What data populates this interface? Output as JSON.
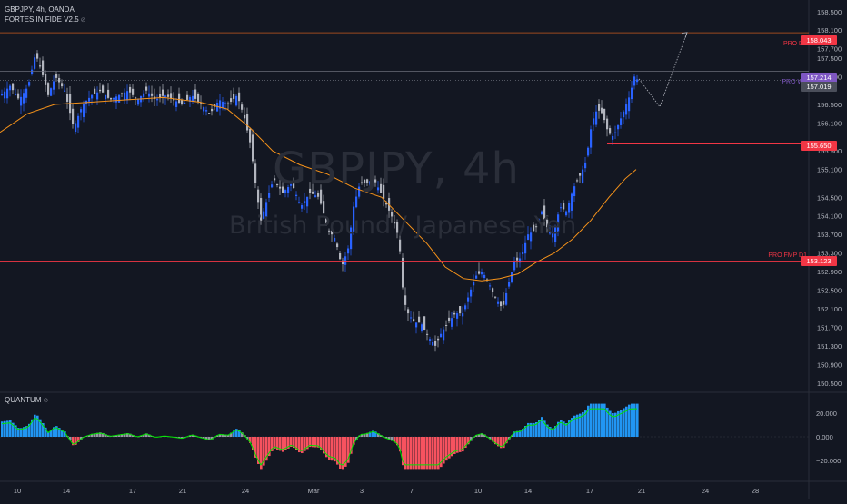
{
  "header": {
    "symbol_line": "GBPJPY, 4h, OANDA",
    "indicator_line": "FORTES IN FIDE V2.5",
    "eye_icon": "eye-slash-icon"
  },
  "watermark": {
    "symbol": "GBPJPY, 4h",
    "description": "British Pound / Japanese Yen"
  },
  "price_axis": {
    "ticks": [
      "158.500",
      "158.100",
      "157.700",
      "157.500",
      "157.100",
      "156.500",
      "156.100",
      "155.500",
      "155.100",
      "154.500",
      "154.100",
      "153.700",
      "153.300",
      "152.900",
      "152.500",
      "152.100",
      "151.700",
      "151.300",
      "150.900",
      "150.500"
    ],
    "tick_values": [
      158.5,
      158.1,
      157.7,
      157.5,
      157.1,
      156.5,
      156.1,
      155.5,
      155.1,
      154.5,
      154.1,
      153.7,
      153.3,
      152.9,
      152.5,
      152.1,
      151.7,
      151.3,
      150.9,
      150.5
    ]
  },
  "levels": [
    {
      "name": "PRO D1",
      "value": "158.043",
      "price": 158.043,
      "color": "#f23645",
      "line_color": "#9c4a1f",
      "label_color": "#f23645"
    },
    {
      "name": "PRO W1",
      "value": "157.214",
      "price": 157.214,
      "color": "#7e57c2",
      "line_color": "#6a6d78",
      "label_color": "#7e57c2"
    },
    {
      "name": "",
      "value": "155.650",
      "price": 155.65,
      "color": "#f23645",
      "line_color": "#f23645",
      "label_color": "#f23645"
    },
    {
      "name": "PRO FMP D1",
      "value": "153.123",
      "price": 153.123,
      "color": "#f23645",
      "line_color": "#f23645",
      "label_color": "#f23645"
    }
  ],
  "last_price": {
    "value": "157.019",
    "price": 157.019,
    "color": "#4a4e5a"
  },
  "time_axis": {
    "labels": [
      "10",
      "14",
      "17",
      "21",
      "24",
      "Mar",
      "3",
      "7",
      "10",
      "14",
      "17",
      "21",
      "24",
      "28"
    ]
  },
  "sub_pane": {
    "title": "QUANTUM",
    "eye_icon": "eye-slash-icon",
    "ticks": [
      "20.000",
      "0.000",
      "−20.000"
    ],
    "tick_values": [
      20,
      0,
      -20
    ]
  },
  "colors": {
    "background": "#131722",
    "bull": "#2962ff",
    "bear": "#b2b5be",
    "ma": "#f7931a",
    "hist_pos": "#2196f3",
    "hist_neg": "#f7525f",
    "hist_neutral": "#9598a1",
    "signal": "#00e600",
    "grid": "#1e222d"
  },
  "chart_data": {
    "type": "candlestick",
    "timeframe": "4h",
    "ylim": [
      150.3,
      158.75
    ],
    "close_path": [
      [
        0,
        156.7
      ],
      [
        10,
        156.9
      ],
      [
        20,
        156.6
      ],
      [
        30,
        156.9
      ],
      [
        38,
        157.6
      ],
      [
        45,
        157.2
      ],
      [
        52,
        156.7
      ],
      [
        60,
        157.1
      ],
      [
        70,
        156.8
      ],
      [
        80,
        156.0
      ],
      [
        90,
        156.5
      ],
      [
        100,
        156.7
      ],
      [
        110,
        156.8
      ],
      [
        120,
        156.6
      ],
      [
        130,
        156.7
      ],
      [
        140,
        156.8
      ],
      [
        150,
        156.6
      ],
      [
        160,
        156.8
      ],
      [
        170,
        156.6
      ],
      [
        180,
        156.7
      ],
      [
        190,
        156.6
      ],
      [
        200,
        156.5
      ],
      [
        210,
        156.7
      ],
      [
        220,
        156.5
      ],
      [
        230,
        156.3
      ],
      [
        240,
        156.6
      ],
      [
        250,
        156.5
      ],
      [
        260,
        156.7
      ],
      [
        268,
        156.2
      ],
      [
        275,
        155.6
      ],
      [
        280,
        154.8
      ],
      [
        286,
        154.0
      ],
      [
        292,
        154.4
      ],
      [
        300,
        154.9
      ],
      [
        310,
        154.6
      ],
      [
        320,
        154.8
      ],
      [
        330,
        154.3
      ],
      [
        340,
        154.6
      ],
      [
        350,
        154.5
      ],
      [
        360,
        153.8
      ],
      [
        368,
        153.6
      ],
      [
        375,
        153.0
      ],
      [
        382,
        153.4
      ],
      [
        388,
        154.3
      ],
      [
        395,
        154.8
      ],
      [
        402,
        154.8
      ],
      [
        410,
        154.9
      ],
      [
        418,
        154.6
      ],
      [
        425,
        154.3
      ],
      [
        432,
        154.0
      ],
      [
        438,
        153.6
      ],
      [
        443,
        152.3
      ],
      [
        448,
        152.0
      ],
      [
        455,
        151.8
      ],
      [
        462,
        151.8
      ],
      [
        470,
        151.5
      ],
      [
        478,
        151.3
      ],
      [
        485,
        151.6
      ],
      [
        492,
        151.8
      ],
      [
        500,
        152.0
      ],
      [
        508,
        152.0
      ],
      [
        515,
        152.4
      ],
      [
        522,
        152.8
      ],
      [
        530,
        152.9
      ],
      [
        538,
        152.6
      ],
      [
        545,
        152.3
      ],
      [
        552,
        152.1
      ],
      [
        558,
        152.6
      ],
      [
        565,
        153.1
      ],
      [
        572,
        153.2
      ],
      [
        580,
        153.7
      ],
      [
        588,
        153.8
      ],
      [
        595,
        154.2
      ],
      [
        602,
        153.8
      ],
      [
        608,
        153.7
      ],
      [
        615,
        154.3
      ],
      [
        622,
        154.2
      ],
      [
        630,
        154.7
      ],
      [
        638,
        155.0
      ],
      [
        644,
        155.3
      ],
      [
        650,
        156.1
      ],
      [
        656,
        156.4
      ],
      [
        662,
        156.3
      ],
      [
        668,
        155.9
      ],
      [
        674,
        155.8
      ],
      [
        680,
        156.1
      ],
      [
        686,
        156.4
      ],
      [
        692,
        156.7
      ],
      [
        697,
        157.1
      ],
      [
        701,
        157.02
      ]
    ],
    "ma_path": [
      [
        0,
        155.9
      ],
      [
        30,
        156.3
      ],
      [
        60,
        156.5
      ],
      [
        100,
        156.55
      ],
      [
        140,
        156.6
      ],
      [
        180,
        156.65
      ],
      [
        220,
        156.55
      ],
      [
        250,
        156.4
      ],
      [
        275,
        156.0
      ],
      [
        300,
        155.5
      ],
      [
        330,
        155.2
      ],
      [
        360,
        155.0
      ],
      [
        390,
        154.7
      ],
      [
        420,
        154.5
      ],
      [
        445,
        154.0
      ],
      [
        470,
        153.5
      ],
      [
        490,
        153.0
      ],
      [
        510,
        152.75
      ],
      [
        530,
        152.7
      ],
      [
        550,
        152.75
      ],
      [
        570,
        152.85
      ],
      [
        590,
        153.1
      ],
      [
        610,
        153.3
      ],
      [
        630,
        153.6
      ],
      [
        650,
        154.0
      ],
      [
        670,
        154.5
      ],
      [
        688,
        154.9
      ],
      [
        700,
        155.1
      ]
    ],
    "projection_path": [
      [
        703,
        157.05
      ],
      [
        726,
        156.45
      ],
      [
        756,
        158.05
      ]
    ]
  }
}
